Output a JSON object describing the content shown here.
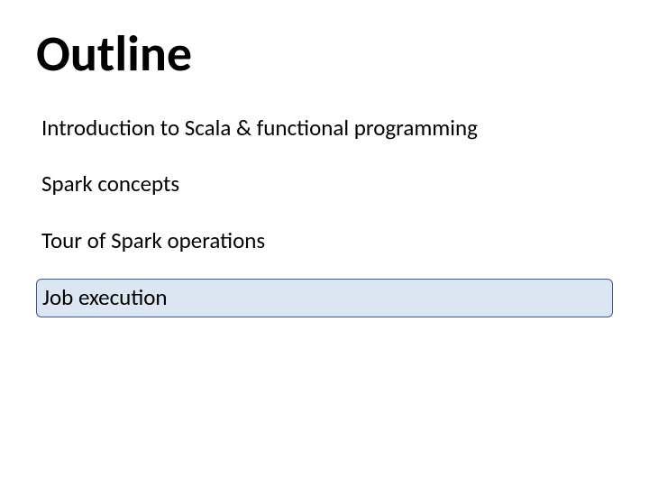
{
  "title": "Outline",
  "items": [
    {
      "label": "Introduction to Scala & functional programming",
      "highlighted": false
    },
    {
      "label": "Spark concepts",
      "highlighted": false
    },
    {
      "label": "Tour of Spark operations",
      "highlighted": false
    },
    {
      "label": "Job execution",
      "highlighted": true
    }
  ]
}
